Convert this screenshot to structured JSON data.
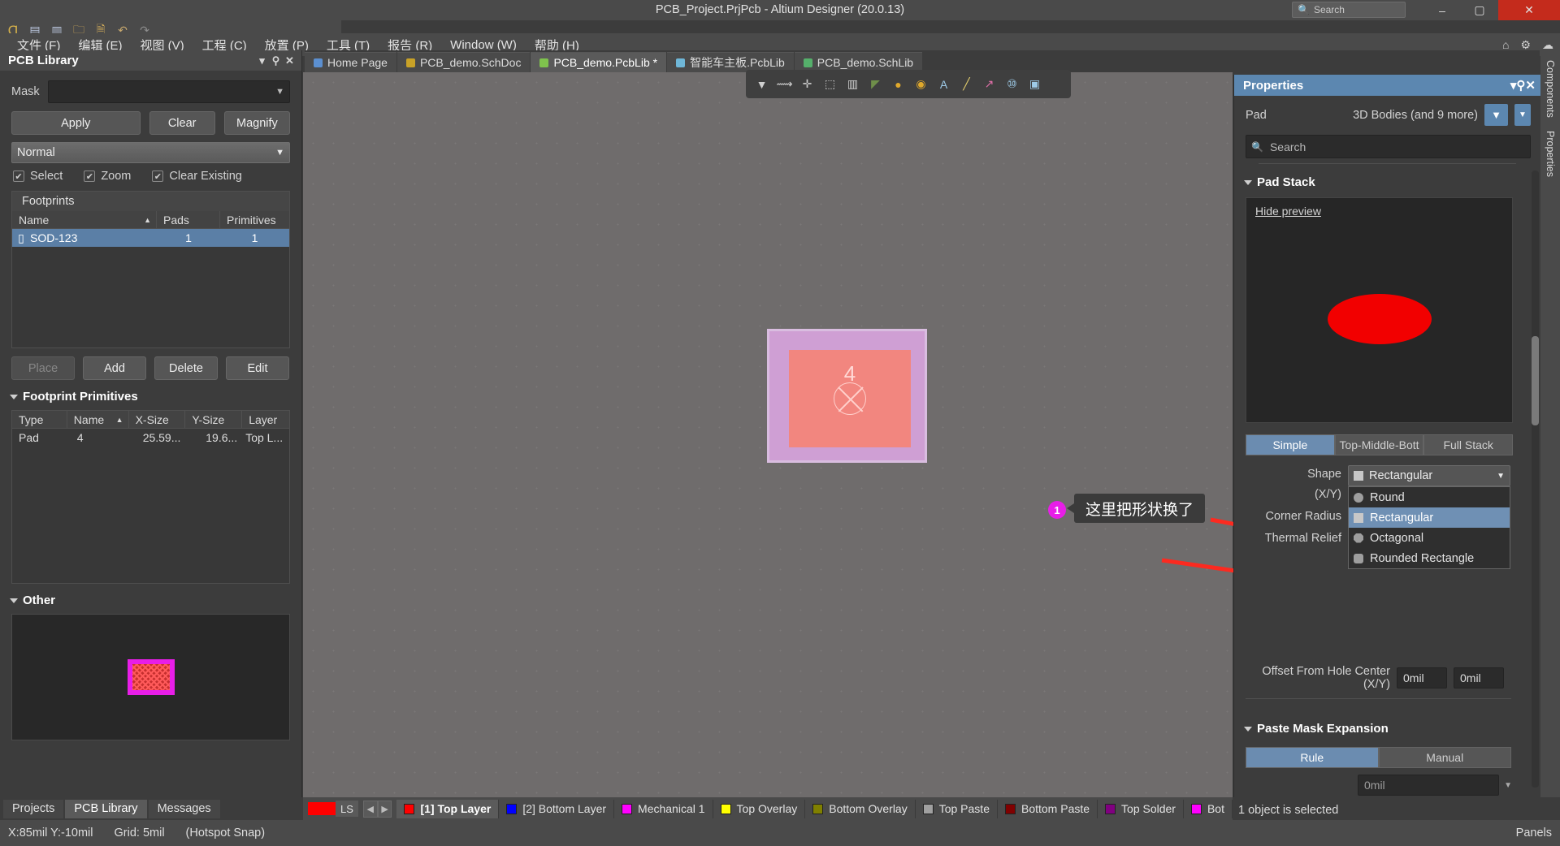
{
  "window": {
    "title": "PCB_Project.PrjPcb - Altium Designer (20.0.13)",
    "search_placeholder": "Search",
    "minimize": "–",
    "maximize": "▢",
    "close": "✕"
  },
  "quick_toolbar": [
    {
      "name": "altium-logo-icon",
      "glyph": "Ɑ"
    },
    {
      "name": "save-icon",
      "glyph": "▤"
    },
    {
      "name": "save-all-icon",
      "glyph": "▥"
    },
    {
      "name": "open-icon",
      "glyph": "🗀"
    },
    {
      "name": "open-project-icon",
      "glyph": "🗎"
    },
    {
      "name": "undo-icon",
      "glyph": "↶"
    },
    {
      "name": "redo-icon",
      "glyph": "↷"
    }
  ],
  "menu": {
    "items": [
      "文件 (F)",
      "编辑 (E)",
      "视图 (V)",
      "工程 (C)",
      "放置 (P)",
      "工具 (T)",
      "报告 (R)",
      "Window (W)",
      "帮助 (H)"
    ],
    "right_icons": [
      {
        "name": "home-icon",
        "glyph": "⌂"
      },
      {
        "name": "settings-gear-icon",
        "glyph": "⚙"
      },
      {
        "name": "account-icon",
        "glyph": "☁"
      }
    ]
  },
  "doc_tabs": [
    {
      "label": "Home Page",
      "color": "#5b8fd0",
      "active": false
    },
    {
      "label": "PCB_demo.SchDoc",
      "color": "#c9a227",
      "active": false
    },
    {
      "label": "PCB_demo.PcbLib *",
      "color": "#7fc24d",
      "active": true
    },
    {
      "label": "智能车主板.PcbLib",
      "color": "#6fb7d8",
      "active": false
    },
    {
      "label": "PCB_demo.SchLib",
      "color": "#55b06b",
      "active": false
    }
  ],
  "pcb_library": {
    "title": "PCB Library",
    "header_icons": [
      {
        "name": "panel-dropdown-icon",
        "glyph": "▾"
      },
      {
        "name": "panel-pin-icon",
        "glyph": "⚲"
      },
      {
        "name": "panel-close-icon",
        "glyph": "✕"
      }
    ],
    "mask_label": "Mask",
    "mask_value": "",
    "buttons": {
      "apply": "Apply",
      "clear": "Clear",
      "magnify": "Magnify"
    },
    "mode_select": "Normal",
    "checkboxes": [
      {
        "label": "Select",
        "checked": true
      },
      {
        "label": "Zoom",
        "checked": true
      },
      {
        "label": "Clear Existing",
        "checked": true
      }
    ],
    "footprints": {
      "group_title": "Footprints",
      "columns": [
        "Name",
        "Pads",
        "Primitives"
      ],
      "sort_col": 0,
      "rows": [
        {
          "name": "SOD-123",
          "pads": "1",
          "primitives": "1",
          "selected": true
        }
      ]
    },
    "list_buttons": [
      {
        "label": "Place",
        "disabled": true
      },
      {
        "label": "Add",
        "disabled": false
      },
      {
        "label": "Delete",
        "disabled": false
      },
      {
        "label": "Edit",
        "disabled": false
      }
    ],
    "primitives": {
      "section_title": "Footprint Primitives",
      "columns": [
        "Type",
        "Name",
        "X-Size",
        "Y-Size",
        "Layer"
      ],
      "sort_col": 1,
      "rows": [
        {
          "type": "Pad",
          "name": "4",
          "x_size": "25.59...",
          "y_size": "19.6...",
          "layer": "Top L..."
        }
      ]
    },
    "other": {
      "section_title": "Other"
    }
  },
  "canvas": {
    "mini_toolbar": [
      {
        "name": "filter-icon",
        "glyph": "▼"
      },
      {
        "name": "net-icon",
        "glyph": "⟿"
      },
      {
        "name": "crosshair-icon",
        "glyph": "✛"
      },
      {
        "name": "select-area-icon",
        "glyph": "⬚"
      },
      {
        "name": "measure-icon",
        "glyph": "▥"
      },
      {
        "name": "layer-stack-icon",
        "glyph": "◤"
      },
      {
        "name": "circle-pad-icon",
        "glyph": "●"
      },
      {
        "name": "via-icon",
        "glyph": "◉"
      },
      {
        "name": "text-icon",
        "glyph": "A"
      },
      {
        "name": "line-icon",
        "glyph": "╱"
      },
      {
        "name": "dimension-icon",
        "glyph": "↗"
      },
      {
        "name": "ruler-icon",
        "glyph": "⑩"
      },
      {
        "name": "region-icon",
        "glyph": "▣"
      }
    ],
    "pad": {
      "designator": "4"
    }
  },
  "annotation": {
    "badge": "1",
    "text": "这里把形状换了"
  },
  "properties": {
    "title": "Properties",
    "header_icons": [
      {
        "name": "panel-dropdown-icon",
        "glyph": "▾"
      },
      {
        "name": "panel-pin-icon",
        "glyph": "⚲"
      },
      {
        "name": "panel-close-icon",
        "glyph": "✕"
      }
    ],
    "object_type": "Pad",
    "object_scope": "3D Bodies (and 9 more)",
    "filter_icon": "filter-icon",
    "search_placeholder": "Search",
    "pad_stack": {
      "section_title": "Pad Stack",
      "hide_preview_link": "Hide preview",
      "stack_modes": [
        {
          "label": "Simple",
          "active": true
        },
        {
          "label": "Top-Middle-Bott",
          "active": false
        },
        {
          "label": "Full Stack",
          "active": false
        }
      ],
      "shape_label": "Shape",
      "shape_value": "Rectangular",
      "shape_options": [
        {
          "label": "Round",
          "swatch": "circle",
          "selected": false
        },
        {
          "label": "Rectangular",
          "swatch": "square",
          "selected": true
        },
        {
          "label": "Octagonal",
          "swatch": "octagon",
          "selected": false
        },
        {
          "label": "Rounded Rectangle",
          "swatch": "roundrect",
          "selected": false
        }
      ],
      "xy_label": "(X/Y)",
      "corner_radius_label": "Corner Radius",
      "thermal_relief_label": "Thermal Relief",
      "offset_label": "Offset From Hole Center (X/Y)",
      "offset_x": "0mil",
      "offset_y": "0mil"
    },
    "paste_mask": {
      "section_title": "Paste Mask Expansion",
      "modes": [
        {
          "label": "Rule",
          "active": true
        },
        {
          "label": "Manual",
          "active": false
        }
      ],
      "value": "0mil"
    },
    "selection_status": "1 object is selected"
  },
  "layers": {
    "ls_label": "LS",
    "ls_color": "#ff0000",
    "prev_glyph": "◀",
    "next_glyph": "▶",
    "tabs": [
      {
        "label": "[1] Top Layer",
        "color": "#ff0000",
        "active": true
      },
      {
        "label": "[2] Bottom Layer",
        "color": "#0000ff",
        "active": false
      },
      {
        "label": "Mechanical 1",
        "color": "#ff00ff",
        "active": false
      },
      {
        "label": "Top Overlay",
        "color": "#ffff00",
        "active": false
      },
      {
        "label": "Bottom Overlay",
        "color": "#808000",
        "active": false
      },
      {
        "label": "Top Paste",
        "color": "#a0a0a0",
        "active": false
      },
      {
        "label": "Bottom Paste",
        "color": "#800000",
        "active": false
      },
      {
        "label": "Top Solder",
        "color": "#800080",
        "active": false
      },
      {
        "label": "Bot",
        "color": "#ff00ff",
        "active": false
      }
    ]
  },
  "panel_tabs": [
    {
      "label": "Projects",
      "active": false
    },
    {
      "label": "PCB Library",
      "active": true
    },
    {
      "label": "Messages",
      "active": false
    }
  ],
  "status_bar": {
    "coords": "X:85mil Y:-10mil",
    "grid": "Grid: 5mil",
    "snap": "(Hotspot Snap)",
    "panels_button": "Panels"
  },
  "vertical_dock": [
    "Components",
    "Properties"
  ]
}
